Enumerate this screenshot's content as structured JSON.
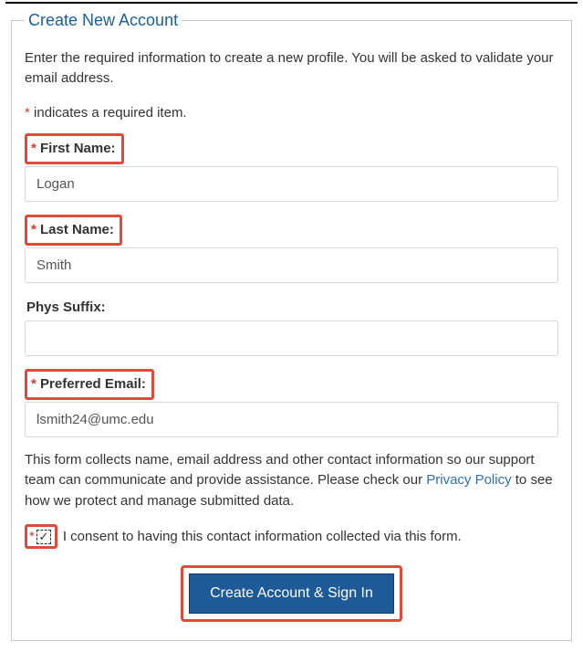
{
  "legend": "Create New Account",
  "intro": "Enter the required information to create a new profile. You will be asked to validate your email address.",
  "required_note": "indicates a required item.",
  "asterisk": "*",
  "fields": {
    "first_name": {
      "label": "First Name:",
      "value": "Logan",
      "required": true,
      "highlighted": true
    },
    "last_name": {
      "label": "Last Name:",
      "value": "Smith",
      "required": true,
      "highlighted": true
    },
    "suffix": {
      "label": "Phys Suffix:",
      "value": "",
      "required": false,
      "highlighted": false
    },
    "email": {
      "label": "Preferred Email:",
      "value": "lsmith24@umc.edu",
      "required": true,
      "highlighted": true
    }
  },
  "privacy": {
    "pre": "This form collects name, email address and other contact information so our support team can communicate and provide assistance. Please check our ",
    "link": "Privacy Policy",
    "post": " to see how we protect and manage submitted data."
  },
  "consent": {
    "checked": true,
    "checkmark": "✓",
    "text": "I consent to having this contact information collected via this form."
  },
  "submit_label": "Create Account & Sign In"
}
